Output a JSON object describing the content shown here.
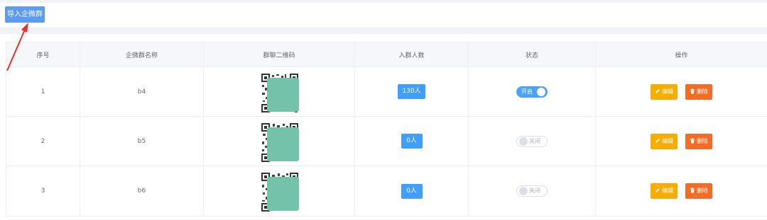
{
  "toolbar": {
    "import_label": "导入企微群"
  },
  "table": {
    "headers": {
      "index": "序号",
      "name": "企微群名称",
      "qrcode": "群聊二维码",
      "members": "入群人数",
      "status": "状态",
      "actions": "操作"
    },
    "rows": [
      {
        "index": "1",
        "name": "b4",
        "members": "130人",
        "status_on": true,
        "status_label": "开启"
      },
      {
        "index": "2",
        "name": "b5",
        "members": "0人",
        "status_on": false,
        "status_label": "关闭"
      },
      {
        "index": "3",
        "name": "b6",
        "members": "0人",
        "status_on": false,
        "status_label": "关闭"
      }
    ],
    "edit_label": "编辑",
    "delete_label": "删除"
  },
  "colors": {
    "primary": "#409eff",
    "warning": "#f7ad00",
    "danger": "#f56c25",
    "annotation_arrow": "#e8302a",
    "qr_mask": "#74c2a9"
  },
  "icons": [
    "edit-icon",
    "trash-icon",
    "qrcode-icon",
    "arrow-annotation-icon"
  ]
}
